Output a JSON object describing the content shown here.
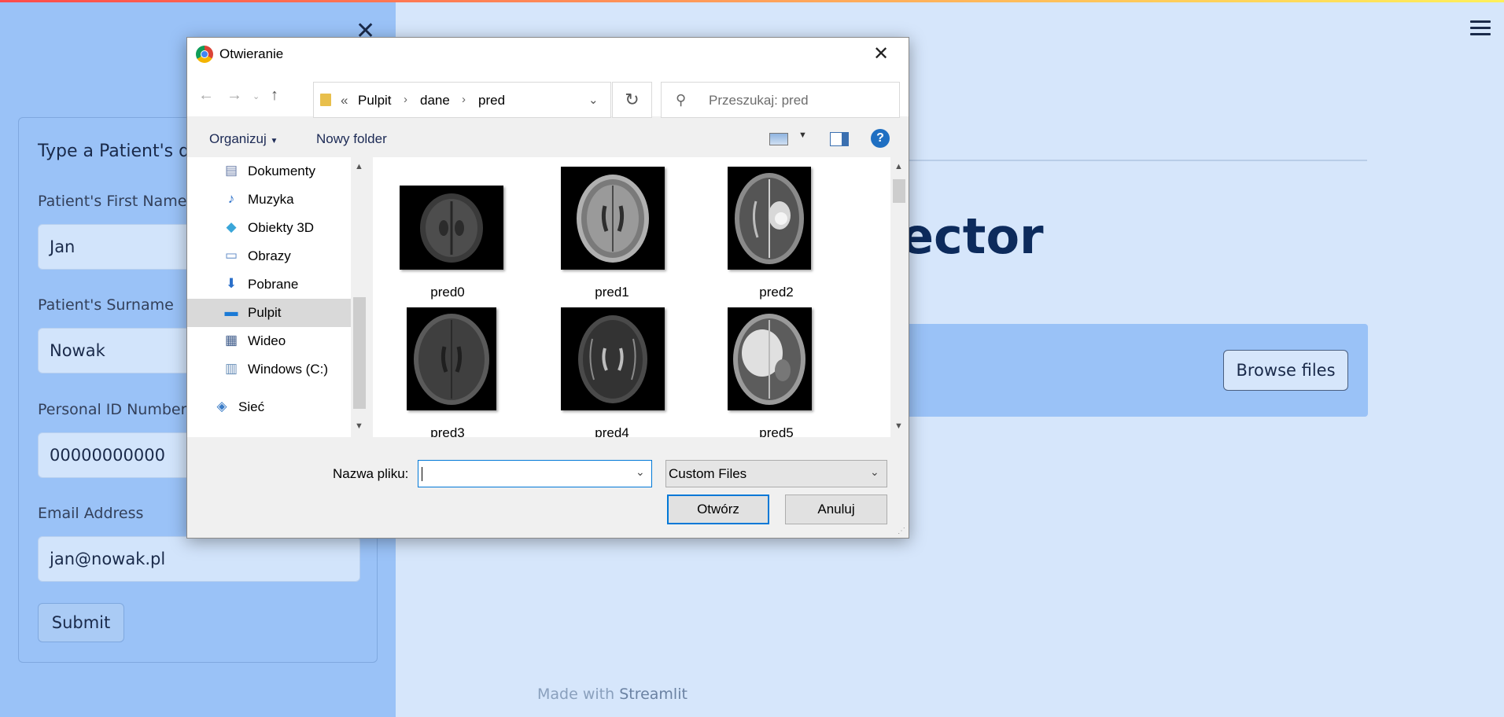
{
  "app": {
    "sidebar": {
      "form_title": "Type a Patient's dat",
      "fields": [
        {
          "label": "Patient's First Name",
          "value": "Jan"
        },
        {
          "label": "Patient's Surname",
          "value": "Nowak"
        },
        {
          "label": "Personal ID Number",
          "value": "00000000000"
        },
        {
          "label": "Email Address",
          "value": "jan@nowak.pl"
        }
      ],
      "submit_label": "Submit"
    },
    "main": {
      "title_fragment": "ector",
      "browse_label": "Browse files",
      "footer_prefix": "Made with",
      "footer_link": "Streamlit"
    }
  },
  "dialog": {
    "title": "Otwieranie",
    "breadcrumb": [
      "Pulpit",
      "dane",
      "pred"
    ],
    "breadcrumb_overflow": "«",
    "search_placeholder": "Przeszukaj: pred",
    "toolbar": {
      "organize": "Organizuj",
      "new_folder": "Nowy folder"
    },
    "tree": [
      {
        "label": "Dokumenty",
        "icon": "documents-icon"
      },
      {
        "label": "Muzyka",
        "icon": "music-icon"
      },
      {
        "label": "Obiekty 3D",
        "icon": "objects-3d-icon"
      },
      {
        "label": "Obrazy",
        "icon": "pictures-icon"
      },
      {
        "label": "Pobrane",
        "icon": "downloads-icon"
      },
      {
        "label": "Pulpit",
        "icon": "desktop-icon",
        "selected": true
      },
      {
        "label": "Wideo",
        "icon": "video-icon"
      },
      {
        "label": "Windows (C:)",
        "icon": "drive-icon"
      },
      {
        "label": "Sieć",
        "icon": "network-icon"
      }
    ],
    "files": [
      {
        "name": "pred0"
      },
      {
        "name": "pred1"
      },
      {
        "name": "pred2"
      },
      {
        "name": "pred3"
      },
      {
        "name": "pred4"
      },
      {
        "name": "pred5"
      }
    ],
    "filename_label": "Nazwa pliku:",
    "filename_value": "",
    "file_type": "Custom Files",
    "open_label": "Otwórz",
    "cancel_label": "Anuluj"
  },
  "colors": {
    "sidebar_bg": "#9ac2f7",
    "main_bg": "#d6e6fb",
    "title": "#0d2b5c",
    "dialog_accent": "#0078d7"
  }
}
